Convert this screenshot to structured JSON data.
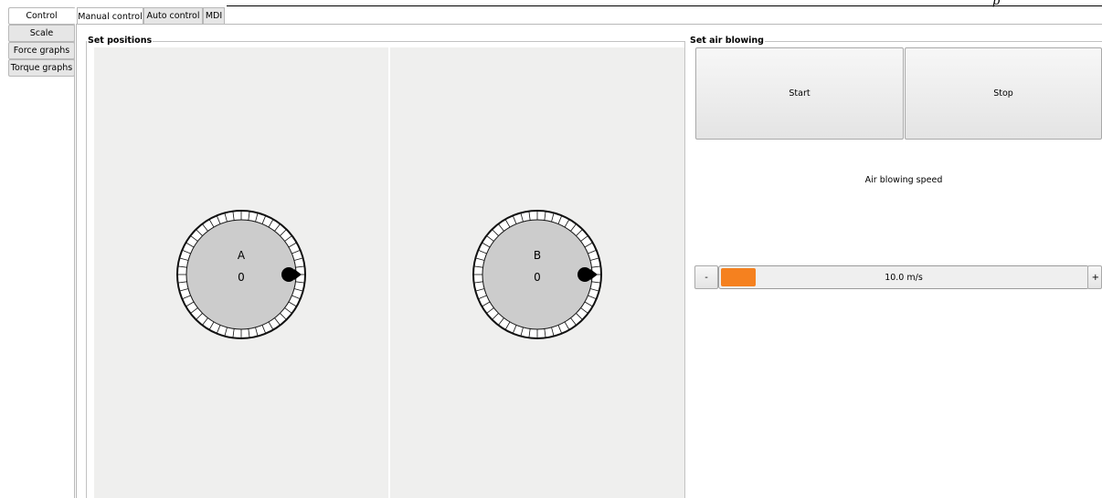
{
  "top_glyph": "p",
  "side_tabs": [
    {
      "label": "Control",
      "active": true
    },
    {
      "label": "Scale",
      "active": false
    },
    {
      "label": "Force graphs",
      "active": false
    },
    {
      "label": "Torque graphs",
      "active": false
    }
  ],
  "top_tabs": [
    {
      "label": "Manual control",
      "active": true
    },
    {
      "label": "Auto control",
      "active": false
    },
    {
      "label": "MDI",
      "active": false
    }
  ],
  "set_positions": {
    "title": "Set positions",
    "dials": [
      {
        "label": "A",
        "value": "0"
      },
      {
        "label": "B",
        "value": "0"
      }
    ]
  },
  "air_blowing": {
    "title": "Set air blowing",
    "start_label": "Start",
    "stop_label": "Stop",
    "speed_label": "Air blowing speed",
    "minus_label": "-",
    "plus_label": "+",
    "speed_value": "10.0 m/s"
  },
  "colors": {
    "accent": "#f5811f",
    "dial_face": "#cccccc",
    "panel_bg": "#efefee"
  }
}
